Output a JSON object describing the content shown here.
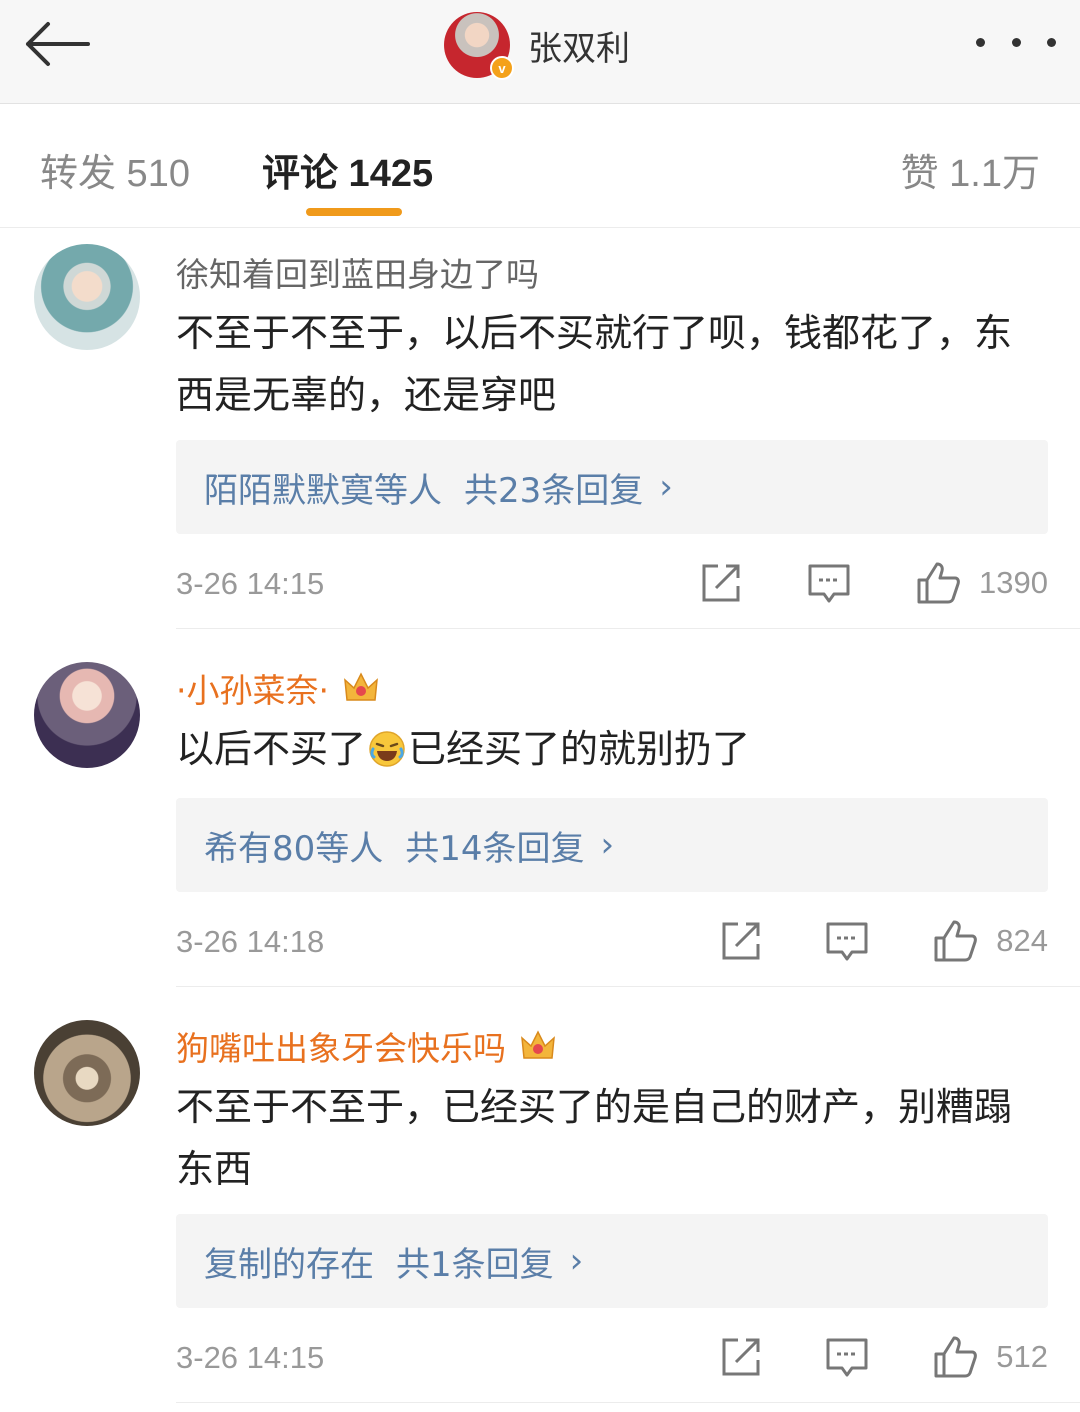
{
  "header": {
    "title": "张双利",
    "verified_mark": "v",
    "back_icon": "arrow-left-icon",
    "more_icon": "more-dots-icon"
  },
  "tabs": {
    "repost": "转发 510",
    "comments": "评论 1425",
    "likes": "赞 1.1万",
    "active_color": "#f09a1b"
  },
  "comments": [
    {
      "name": "徐知着回到蓝田身边了吗",
      "text": "不至于不至于，以后不买就行了呗，钱都花了，东西是无辜的，还是穿吧",
      "reply_users": "陌陌默默寞等人",
      "reply_total": "共23条回复",
      "time": "3-26 14:15",
      "likes": "1390"
    },
    {
      "name": "·小孙菜奈·",
      "text_before": "以后不买了",
      "text_after": "已经买了的就别扔了",
      "reply_users": "希有80等人",
      "reply_total": "共14条回复",
      "time": "3-26 14:18",
      "likes": "824",
      "badge_icon": "crown-badge-icon"
    },
    {
      "name": "狗嘴吐出象牙会快乐吗",
      "text": "不至于不至于，已经买了的是自己的财产，别糟蹋东西",
      "reply_users": "复制的存在",
      "reply_total": "共1条回复",
      "time": "3-26 14:15",
      "likes": "512",
      "badge_icon": "crown-badge-icon"
    }
  ],
  "colors": {
    "link": "#5a7ea8",
    "vip_name": "#e8711f",
    "accent": "#f09a1b"
  }
}
